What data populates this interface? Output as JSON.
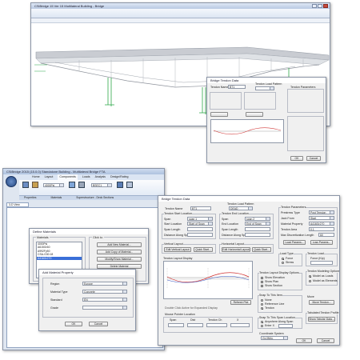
{
  "top_app": {
    "title": "CSiBridge 15 Ver 15 Multilateral Building - Bridge"
  },
  "top_dialog": {
    "title": "Bridge Tendon Data",
    "tendon_name_label": "Tendon Name",
    "tendon_name_value": "BT1",
    "load_pattern_label": "Tendon Load Pattern",
    "tendon_params_label": "Tendon Parameters",
    "ok": "OK",
    "cancel": "Cancel"
  },
  "bottom_app": {
    "title": "CSiBridge 2015 (15.0.0) Standalone Building - Multilateral Bridge FTA",
    "tabs": [
      "Home",
      "Layout",
      "Components",
      "Loads",
      "Analysis",
      "Design/Rating",
      "Advanced",
      "Analyze"
    ],
    "ribbon_groups": [
      "Properties",
      "Materials",
      "Superstructure - Deck Sections"
    ],
    "ribbon_values": [
      "4000Psi",
      "BSEC1"
    ],
    "object_tab": "3-D View"
  },
  "define_materials": {
    "title": "Define Materials",
    "materials_header": "Materials",
    "click_to_header": "Click to:",
    "materials": [
      "4000Psi",
      "A615Gr60",
      "A992Fy50",
      "CSA-G30.18",
      "A416Gr270"
    ],
    "buttons": [
      "Add New Material...",
      "Add Copy of Material...",
      "Modify/Show Material...",
      "Delete Material"
    ]
  },
  "add_material": {
    "title": "Add Material Property",
    "rows": [
      {
        "label": "Region",
        "value": "Europe"
      },
      {
        "label": "Material Type",
        "value": "Concrete"
      },
      {
        "label": "Standard",
        "value": "EN"
      },
      {
        "label": "Grade",
        "value": ""
      }
    ],
    "ok": "OK",
    "cancel": "Cancel"
  },
  "tendon_dialog": {
    "title": "Bridge Tendon Data",
    "tendon_name_label": "Tendon Name",
    "tendon_name_value": "BT1",
    "load_pattern_label": "Tendon Load Pattern",
    "load_pattern_value": "DEAD",
    "start_location_header": "Tendon Start Location",
    "end_location_header": "Tendon End Location",
    "span_label": "Span",
    "span_start_value": "span 1",
    "span_end_value": "span 2",
    "start_location_label": "Start Location",
    "end_location_label": "End Location",
    "start_location_value": "Start of Span",
    "end_location_value": "End of Span",
    "span_length_label": "Span Length",
    "distance_label": "Distance Along Span",
    "vertical_layout_label": "Vertical Layout",
    "horizontal_layout_label": "Horizontal Layout",
    "edit_vertical": "Edit Vertical Layout",
    "edit_horizontal": "Edit Horizontal Layout",
    "quick_start": "Quick Start...",
    "layout_display_label": "Tendon Layout Display",
    "refresh_plot": "Refresh Plot",
    "double_click_hint": "Double Click Active for Expanded Display",
    "mouse_pointer_label": "Mouse Pointer Location",
    "pointer_cols": [
      "Span",
      "Dist",
      "Tendon Ch",
      "X"
    ],
    "params_header": "Tendon Parameters",
    "params": [
      {
        "label": "Prestress Type",
        "value": "Post Tension"
      },
      {
        "label": "Jack From",
        "value": "Start"
      },
      {
        "label": "Material Property",
        "value": "A416Gr270"
      },
      {
        "label": "Tendon Area",
        "value": "0.1"
      },
      {
        "label": "Max Discretization Length",
        "value": "60"
      }
    ],
    "prestress_button": "Load Params...",
    "loss_button": "Loss Params...",
    "load_type_header": "Load Type",
    "load_type_options": [
      "Force",
      "Stress"
    ],
    "tendon_load_header": "Tendon Load",
    "tendon_load_value": "Force (Kip)",
    "modeling_header": "Tendon Modeling Options",
    "modeling_options": [
      "Model as Loads",
      "Model as Elements"
    ],
    "layout_display_header": "Tendon Layout Display Options",
    "display_options": [
      "Show Elevation",
      "Show Plan",
      "Show Section"
    ],
    "snap_header": "Snap To This Item",
    "snap_options": [
      "None",
      "Reference Line",
      "Tendon"
    ],
    "snap_loc_header": "Snap To This Span Location",
    "snap_loc_options": [
      "Anywhere Along Span",
      "Enter X"
    ],
    "coord_header": "Coordinate System",
    "coord_value": "GLOBAL",
    "move_label": "Move",
    "move_button": "Move Tendon...",
    "tabulated_header": "Tabulated Tendon Profile",
    "tabulated_button": "Show Tabular Data...",
    "ok": "OK",
    "cancel": "Cancel"
  }
}
